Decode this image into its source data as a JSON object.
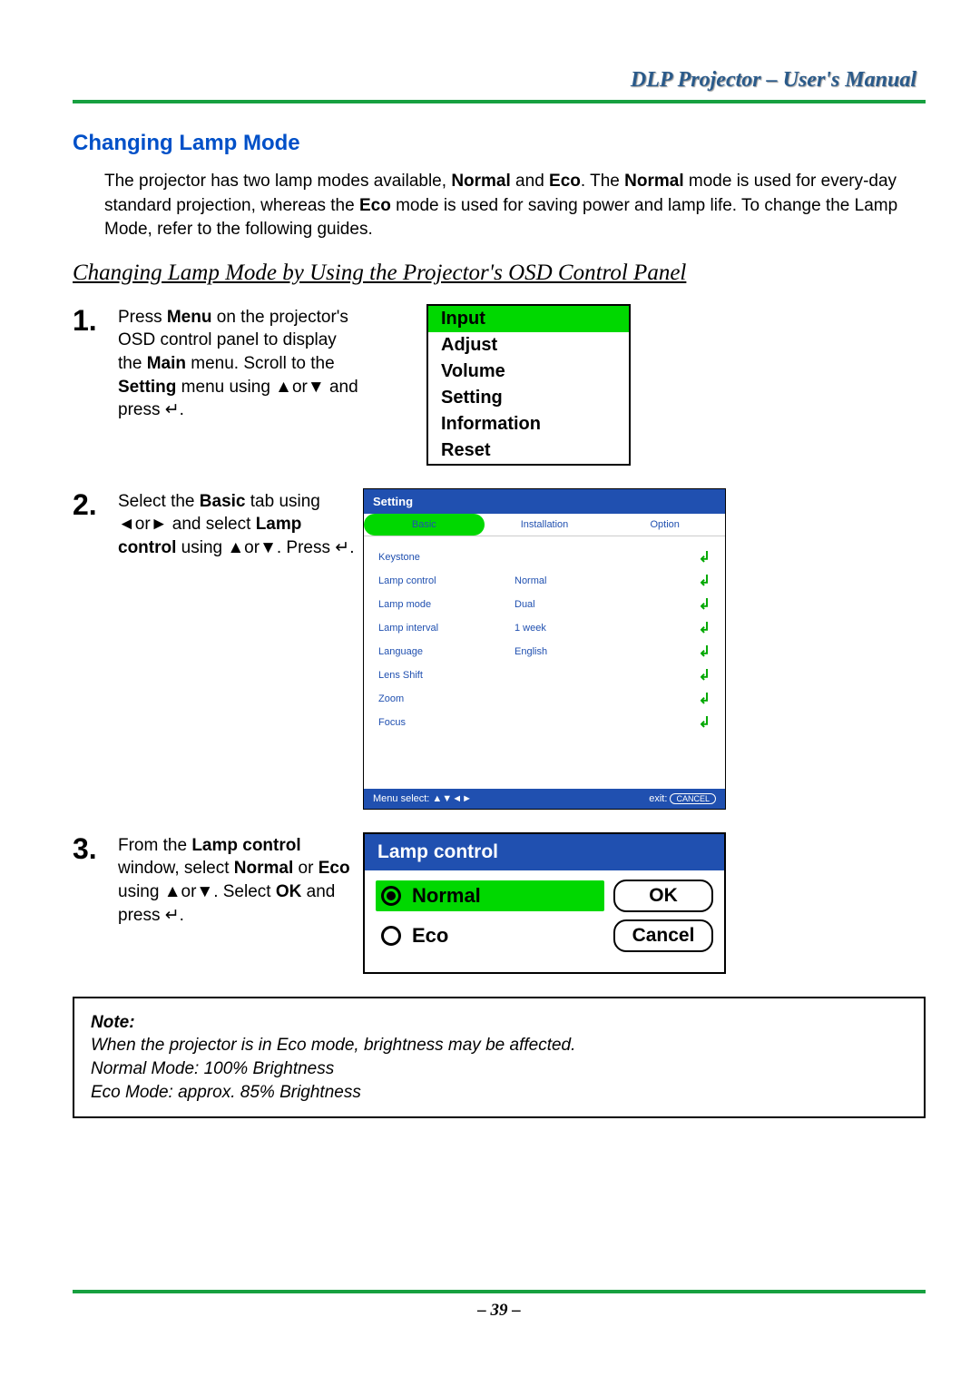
{
  "header": {
    "title": "DLP Projector – User's Manual"
  },
  "section": {
    "title": "Changing Lamp Mode",
    "intro_pre": "The projector has two lamp modes available, ",
    "intro_normal": "Normal",
    "intro_mid1": " and ",
    "intro_eco": "Eco",
    "intro_mid2": ". The ",
    "intro_normal2": "Normal",
    "intro_mid3": " mode is used for every-day standard projection, whereas the ",
    "intro_eco2": "Eco",
    "intro_end": " mode is used for saving power and lamp life. To change the Lamp Mode, refer to the following guides.",
    "subtitle": "Changing Lamp Mode by Using the Projector's OSD Control Panel"
  },
  "steps": [
    {
      "num": "1.",
      "t1": "Press ",
      "b1": "Menu",
      "t2": " on the projector's OSD control panel to display the ",
      "b2": "Main",
      "t3": " menu. Scroll to the ",
      "b3": "Setting",
      "t4": " menu using ▲or▼ and press ↵."
    },
    {
      "num": "2.",
      "t1": "Select the ",
      "b1": "Basic",
      "t2": " tab using ◄or► and select ",
      "b2": "Lamp control",
      "t3": " using ▲or▼. Press ↵."
    },
    {
      "num": "3.",
      "t1": "From the ",
      "b1": "Lamp control",
      "t2": " window, select ",
      "b2": "Normal",
      "t3": " or ",
      "b3": "Eco",
      "t4": " using ▲or▼. Select ",
      "b4": "OK",
      "t5": " and press ↵."
    }
  ],
  "fig1": {
    "items": [
      "Input",
      "Adjust",
      "Volume",
      "Setting",
      "Information",
      "Reset"
    ],
    "selected": 0
  },
  "fig2": {
    "header": "Setting",
    "tabs": [
      "Basic",
      "Installation",
      "Option"
    ],
    "active_tab": 0,
    "rows": [
      {
        "label": "Keystone",
        "value": ""
      },
      {
        "label": "Lamp control",
        "value": "Normal"
      },
      {
        "label": "Lamp mode",
        "value": "Dual"
      },
      {
        "label": "Lamp interval",
        "value": "1 week"
      },
      {
        "label": "Language",
        "value": "English"
      },
      {
        "label": "Lens Shift",
        "value": ""
      },
      {
        "label": "Zoom",
        "value": ""
      },
      {
        "label": "Focus",
        "value": ""
      }
    ],
    "footer_left": "Menu select: ▲▼◄►",
    "footer_exit_prefix": "exit:",
    "footer_exit_btn": "CANCEL"
  },
  "fig3": {
    "header": "Lamp control",
    "options": [
      {
        "label": "Normal",
        "selected": true,
        "button": "OK"
      },
      {
        "label": "Eco",
        "selected": false,
        "button": "Cancel"
      }
    ]
  },
  "note": {
    "label": "Note:",
    "lines": [
      "When the projector is in Eco mode, brightness may be affected.",
      "Normal Mode: 100% Brightness",
      "Eco Mode: approx. 85% Brightness"
    ]
  },
  "page_number": "– 39 –"
}
